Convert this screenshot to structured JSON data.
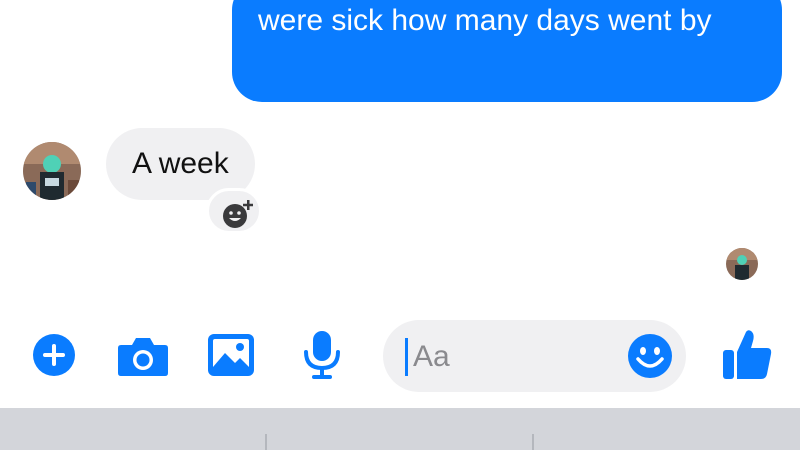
{
  "messages": {
    "sent": {
      "text": "were sick how many days went by"
    },
    "received": {
      "text": "A week"
    }
  },
  "composer": {
    "input_placeholder": "Aa",
    "icons": {
      "plus": "plus-circle-icon",
      "camera": "camera-icon",
      "photo": "photo-icon",
      "mic": "microphone-icon",
      "emoji": "emoji-icon",
      "like": "thumbs-up-icon"
    }
  },
  "colors": {
    "accent": "#0a7cff",
    "received_bubble": "#f0f0f2",
    "keyboard_bar": "#d3d5da"
  }
}
